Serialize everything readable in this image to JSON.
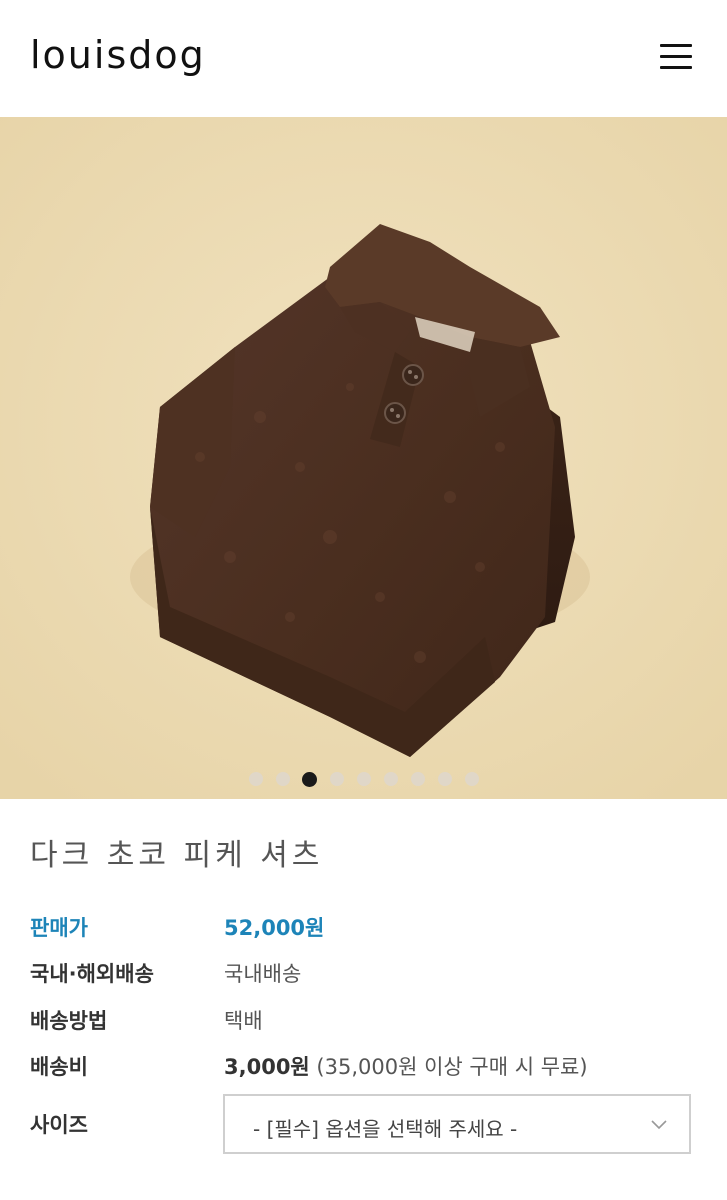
{
  "header": {
    "logo": "louisdog",
    "menu_icon": "hamburger-menu-icon"
  },
  "gallery": {
    "image_subject": "brown dog polo shirt",
    "dot_count": 9,
    "active_index": 2
  },
  "product": {
    "title": "다크 초코 피케 셔츠",
    "rows": {
      "price": {
        "label": "판매가",
        "value": "52,000원"
      },
      "shipping_scope": {
        "label": "국내·해외배송",
        "value": "국내배송"
      },
      "shipping_method": {
        "label": "배송방법",
        "value": "택배"
      },
      "shipping_fee": {
        "label": "배송비",
        "value": "3,000원",
        "note": " (35,000원 이상 구매 시 무료)"
      },
      "size": {
        "label": "사이즈",
        "selected": "- [필수] 옵션을 선택해 주세요 -"
      }
    }
  },
  "colors": {
    "accent": "#1d84b8",
    "background": "#eddcb3",
    "shirt": "#4b2f1f"
  }
}
